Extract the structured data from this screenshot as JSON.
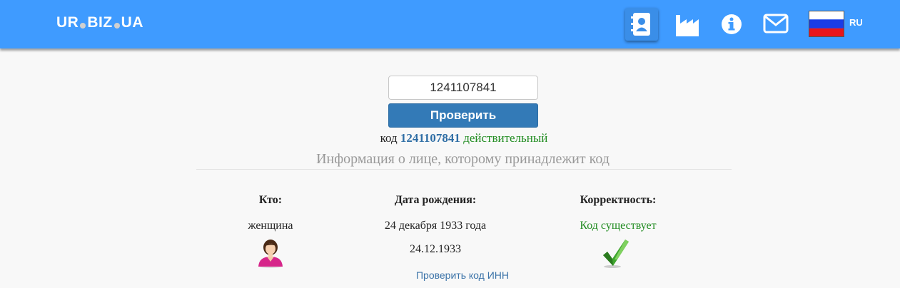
{
  "header": {
    "logo_part1": "UR",
    "logo_part2": "BIZ",
    "logo_part3": "UA",
    "lang": "RU",
    "icons": [
      "contacts-book-icon",
      "factory-icon",
      "info-icon",
      "mail-icon",
      "russia-flag-icon"
    ]
  },
  "search": {
    "value": "1241107841",
    "button_label": "Проверить"
  },
  "result": {
    "prefix": "код",
    "code": "1241107841",
    "status": "действительный",
    "info_title": "Информация о лице, которому принадлежит код"
  },
  "details": {
    "who_label": "Кто:",
    "who_value": "женщина",
    "birth_label": "Дата рождения:",
    "birth_long": "24 декабря 1933 года",
    "birth_short": "24.12.1933",
    "correct_label": "Корректность:",
    "correct_value": "Код существует"
  },
  "footer": {
    "link": "Проверить код ИНН"
  },
  "colors": {
    "header_bg": "#3f9bff",
    "button_bg": "#337ab7",
    "valid_green": "#218c21",
    "code_blue": "#2f6ea5"
  }
}
